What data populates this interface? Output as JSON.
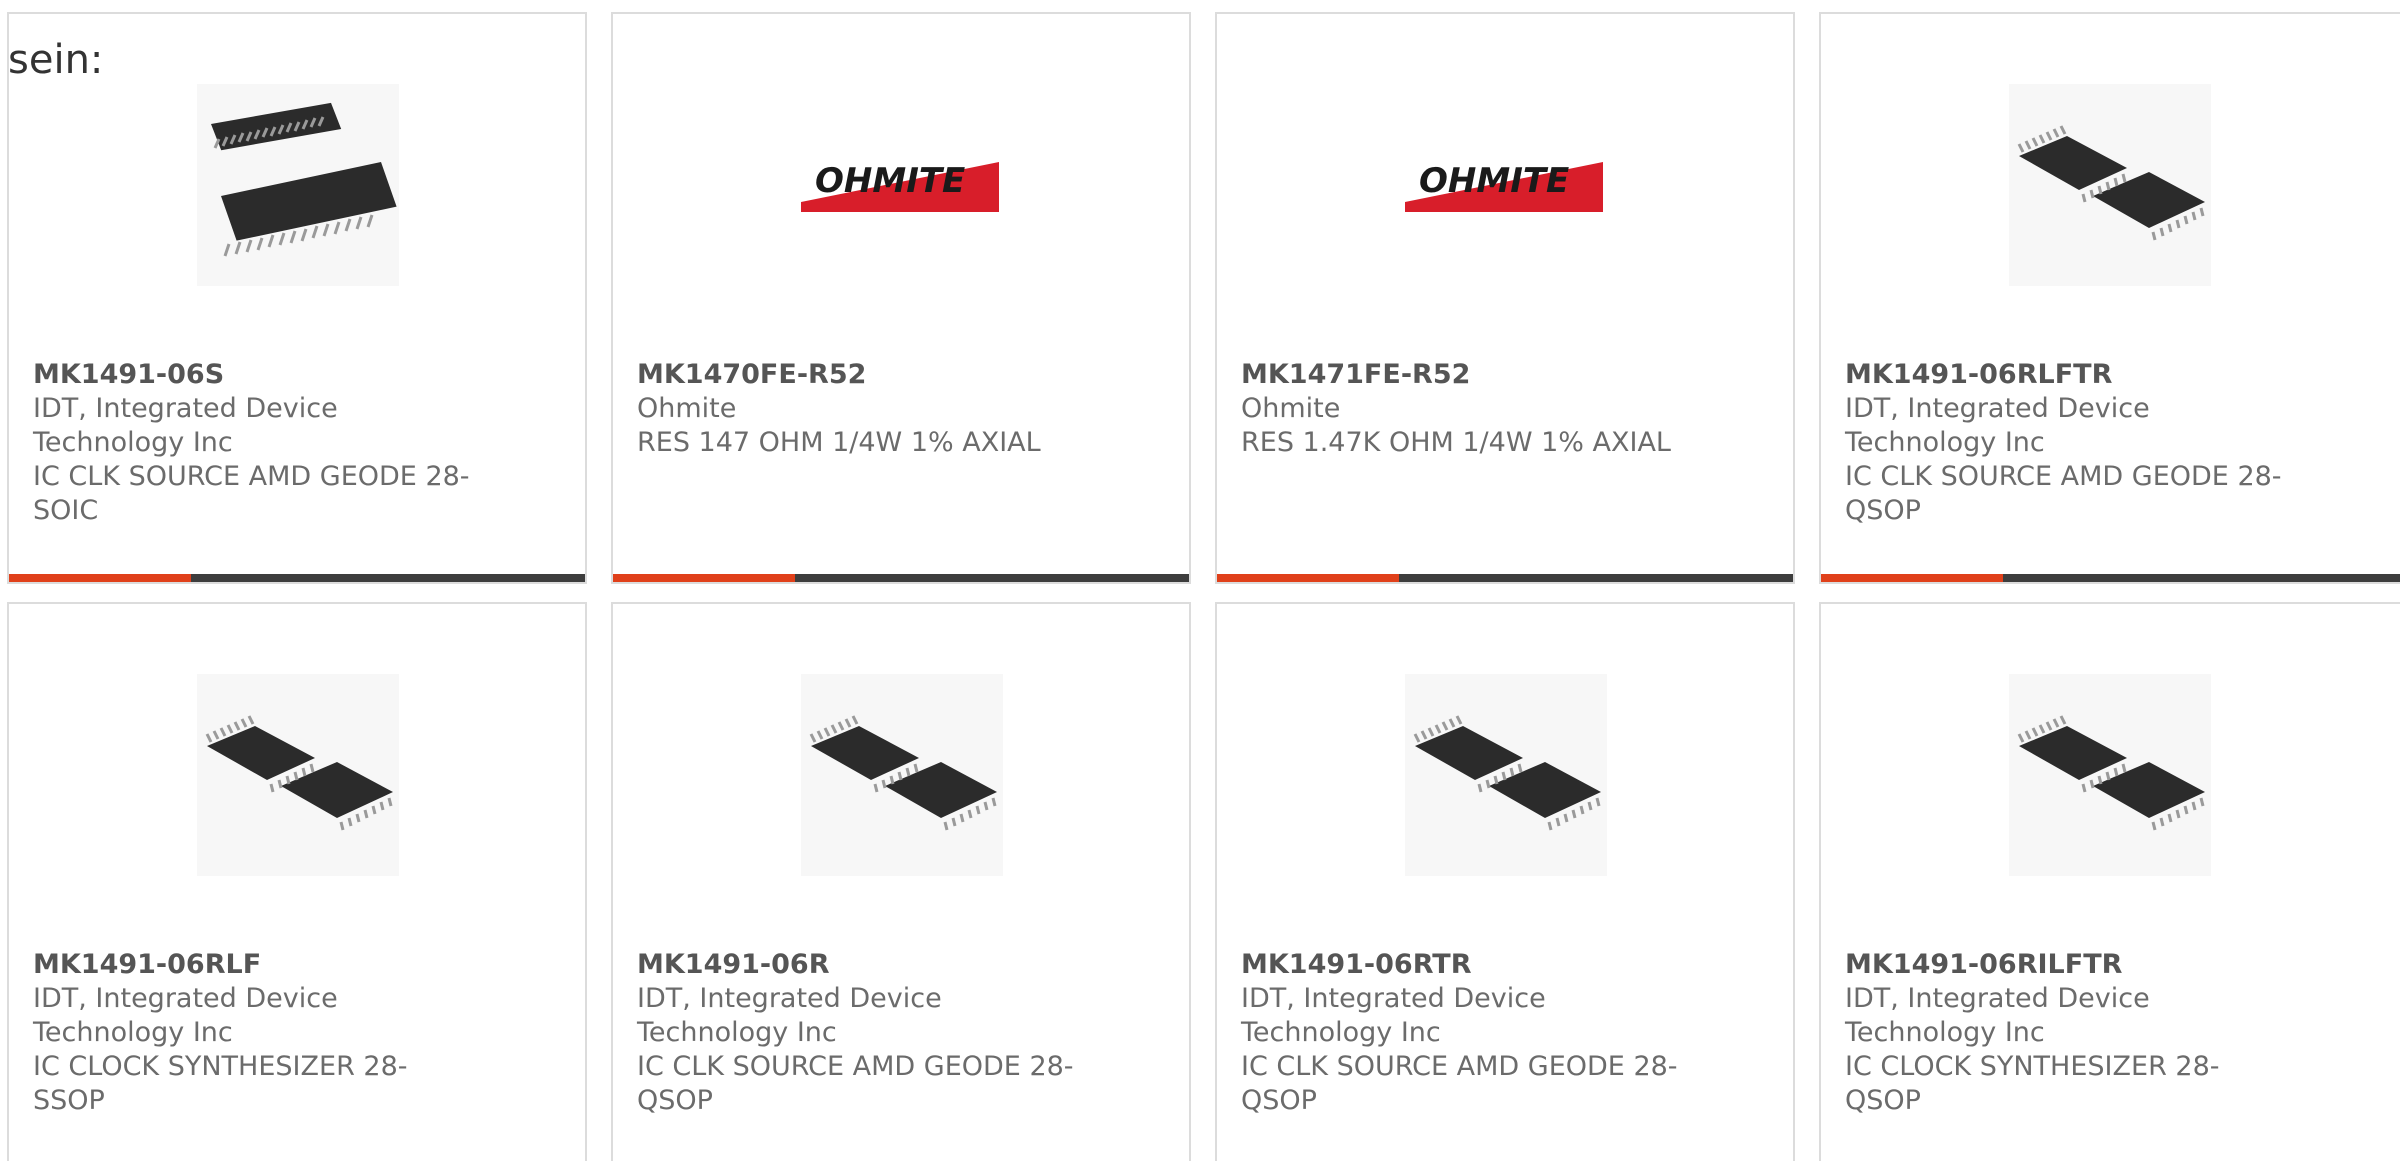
{
  "heading": "sein:",
  "colors": {
    "accent": "#e0401a",
    "bar": "#3d3d3d",
    "ohmite_red": "#d81e2a",
    "text": "#6b6b6b"
  },
  "products": [
    {
      "part_number": "MK1491-06S",
      "manufacturer_line1": "IDT, Integrated Device",
      "manufacturer_line2": "Technology Inc",
      "description_line1": "IC CLK SOURCE AMD GEODE 28-",
      "description_line2": "SOIC",
      "image": "soic-package-image"
    },
    {
      "part_number": "MK1470FE-R52",
      "manufacturer_line1": "Ohmite",
      "manufacturer_line2": "",
      "description_line1": "RES 147 OHM 1/4W 1% AXIAL",
      "description_line2": "",
      "image": "ohmite-logo",
      "logo_text": "OHMITE"
    },
    {
      "part_number": "MK1471FE-R52",
      "manufacturer_line1": "Ohmite",
      "manufacturer_line2": "",
      "description_line1": "RES 1.47K OHM 1/4W 1% AXIAL",
      "description_line2": "",
      "image": "ohmite-logo",
      "logo_text": "OHMITE"
    },
    {
      "part_number": "MK1491-06RLFTR",
      "manufacturer_line1": "IDT, Integrated Device",
      "manufacturer_line2": "Technology Inc",
      "description_line1": "IC CLK SOURCE AMD GEODE 28-",
      "description_line2": "QSOP",
      "image": "qsop-package-image"
    },
    {
      "part_number": "MK1491-06RLF",
      "manufacturer_line1": "IDT, Integrated Device",
      "manufacturer_line2": "Technology Inc",
      "description_line1": "IC CLOCK SYNTHESIZER 28-SSOP",
      "description_line2": "",
      "image": "qsop-package-image"
    },
    {
      "part_number": "MK1491-06R",
      "manufacturer_line1": "IDT, Integrated Device",
      "manufacturer_line2": "Technology Inc",
      "description_line1": "IC CLK SOURCE AMD GEODE 28-",
      "description_line2": "QSOP",
      "image": "qsop-package-image"
    },
    {
      "part_number": "MK1491-06RTR",
      "manufacturer_line1": "IDT, Integrated Device",
      "manufacturer_line2": "Technology Inc",
      "description_line1": "IC CLK SOURCE AMD GEODE 28-",
      "description_line2": "QSOP",
      "image": "qsop-package-image"
    },
    {
      "part_number": "MK1491-06RILFTR",
      "manufacturer_line1": "IDT, Integrated Device",
      "manufacturer_line2": "Technology Inc",
      "description_line1": "IC CLOCK SYNTHESIZER 28-",
      "description_line2": "QSOP",
      "image": "qsop-package-image"
    }
  ]
}
